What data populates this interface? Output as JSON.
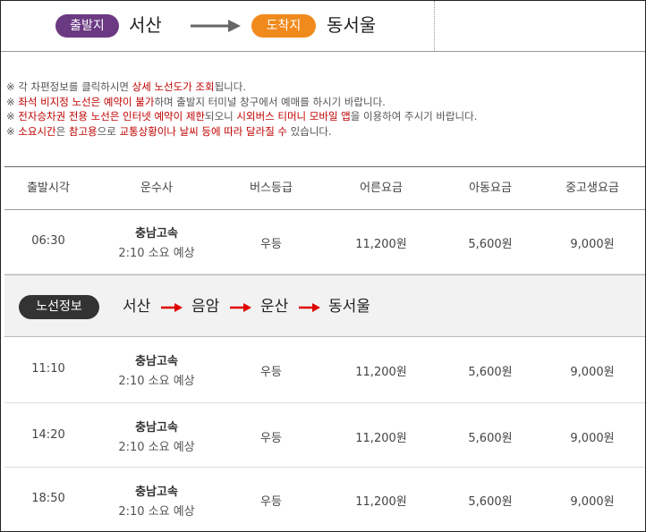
{
  "header": {
    "depart_label": "출발지",
    "depart_city": "서산",
    "arrive_label": "도착지",
    "arrive_city": "동서울"
  },
  "notices": [
    [
      {
        "t": "※ 각 차편정보를 클릭하시면 ",
        "red": false
      },
      {
        "t": "상세 노선도가 조회",
        "red": true
      },
      {
        "t": "됩니다.",
        "red": false
      }
    ],
    [
      {
        "t": "※ ",
        "red": false
      },
      {
        "t": "좌석 비지정 노선은 예약이 불가",
        "red": true
      },
      {
        "t": "하며 출발지 터미널 창구에서 예매를 하시기 바랍니다.",
        "red": false
      }
    ],
    [
      {
        "t": "※ ",
        "red": false
      },
      {
        "t": "전자승차권 전용 노선은 인터넷 예약이 제한",
        "red": true
      },
      {
        "t": "되오니 ",
        "red": false
      },
      {
        "t": "시외버스 티머니 모바일 앱",
        "red": true
      },
      {
        "t": "을 이용하여 주시기 바랍니다.",
        "red": false
      }
    ],
    [
      {
        "t": "※ ",
        "red": false
      },
      {
        "t": "소요시간",
        "red": true
      },
      {
        "t": "은 ",
        "red": false
      },
      {
        "t": "참고용",
        "red": true
      },
      {
        "t": "으로 ",
        "red": false
      },
      {
        "t": "교통상황이나 날씨 등에 따라 달라질 수",
        "red": true
      },
      {
        "t": " 있습니다.",
        "red": false
      }
    ]
  ],
  "table": {
    "headers": [
      "출발시각",
      "운수사",
      "버스등급",
      "어른요금",
      "아동요금",
      "중고생요금"
    ],
    "rows": [
      {
        "time": "06:30",
        "company": "충남고속",
        "duration": "2:10 소요 예상",
        "grade": "우등",
        "adult": "11,200원",
        "child": "5,600원",
        "teen": "9,000원"
      },
      {
        "time": "11:10",
        "company": "충남고속",
        "duration": "2:10 소요 예상",
        "grade": "우등",
        "adult": "11,200원",
        "child": "5,600원",
        "teen": "9,000원"
      },
      {
        "time": "14:20",
        "company": "충남고속",
        "duration": "2:10 소요 예상",
        "grade": "우등",
        "adult": "11,200원",
        "child": "5,600원",
        "teen": "9,000원"
      },
      {
        "time": "18:50",
        "company": "충남고속",
        "duration": "2:10 소요 예상",
        "grade": "우등",
        "adult": "11,200원",
        "child": "5,600원",
        "teen": "9,000원"
      }
    ]
  },
  "route_info": {
    "label": "노선정보",
    "stops": [
      "서산",
      "음암",
      "운산",
      "동서울"
    ]
  },
  "colors": {
    "depart_pill": "#6b3a82",
    "arrive_pill": "#f08a1c",
    "notice_red": "#c00000",
    "route_arrow": "#e00000"
  }
}
